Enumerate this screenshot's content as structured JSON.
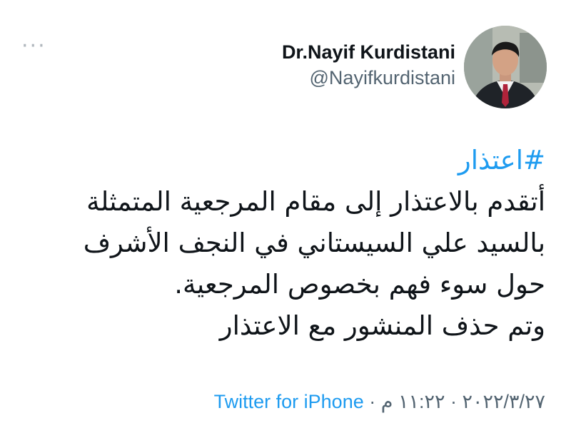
{
  "header": {
    "display_name": "Dr.Nayif Kurdistani",
    "handle": "@Nayifkurdistani",
    "more_label": "···",
    "avatar_icon": "profile-photo-icon"
  },
  "tweet": {
    "hashtag": "#اعتذار",
    "lines": [
      "أتقدم بالاعتذار إلى مقام المرجعية المتمثلة",
      "بالسيد علي السيستاني في النجف الأشرف",
      "حول سوء فهم بخصوص المرجعية.",
      "وتم حذف المنشور مع الاعتذار"
    ]
  },
  "meta": {
    "date": "٢٠٢٢/٣/٢٧",
    "separator": " · ",
    "time": "١١:٢٢ م",
    "source": "Twitter for iPhone"
  },
  "colors": {
    "link": "#1d9bf0",
    "text": "#0f1419",
    "secondary": "#536471"
  }
}
